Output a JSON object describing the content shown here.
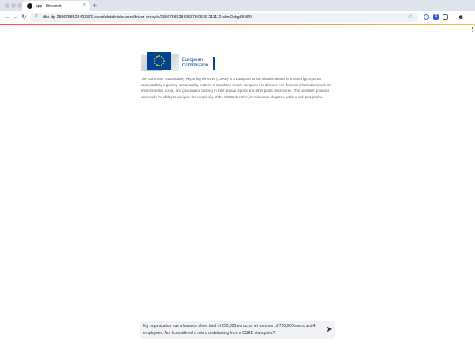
{
  "browser": {
    "tab_title": "app · Streamlit",
    "tab_close": "×",
    "new_tab": "+",
    "url": "dbc-dp-2556758628403379.cloud.databricks.com/driver-proxy/o/2556758628403379/0509-211112-chm2obgl/8484/",
    "extension_s_label": "S"
  },
  "logo": {
    "line1": "European",
    "line2": "Commission"
  },
  "intro_text": "The Corporate Sustainability Reporting Directive (CSRD) is a European Union initiative aimed at enhancing corporate accountability regarding sustainability matters. It mandates certain companies to disclose non-financial information (such as environmental, social, and governance factors) in their annual reports and other public disclosures. This assistant provides users with the ability to navigate the complexity of the CSRD directive, its numerous chapters, articles and paragraphs.",
  "chat_input": {
    "value": "My organization has a balance sheet total of 250,000 euros, a net turnover of 750,000 euros and 4 employees. Am I considered a micro undertaking from a CSRD standpoint?"
  },
  "colors": {
    "accent_start": "#ff4b4b",
    "accent_end": "#ffbd45",
    "eu_blue": "#004494",
    "eu_yellow": "#ffdd00"
  },
  "icons": [
    "back-icon",
    "forward-icon",
    "reload-icon",
    "site-info-icon",
    "star-icon",
    "globe-icon",
    "puzzle-icon",
    "profile-icon",
    "menu-dots-icon",
    "send-icon"
  ]
}
